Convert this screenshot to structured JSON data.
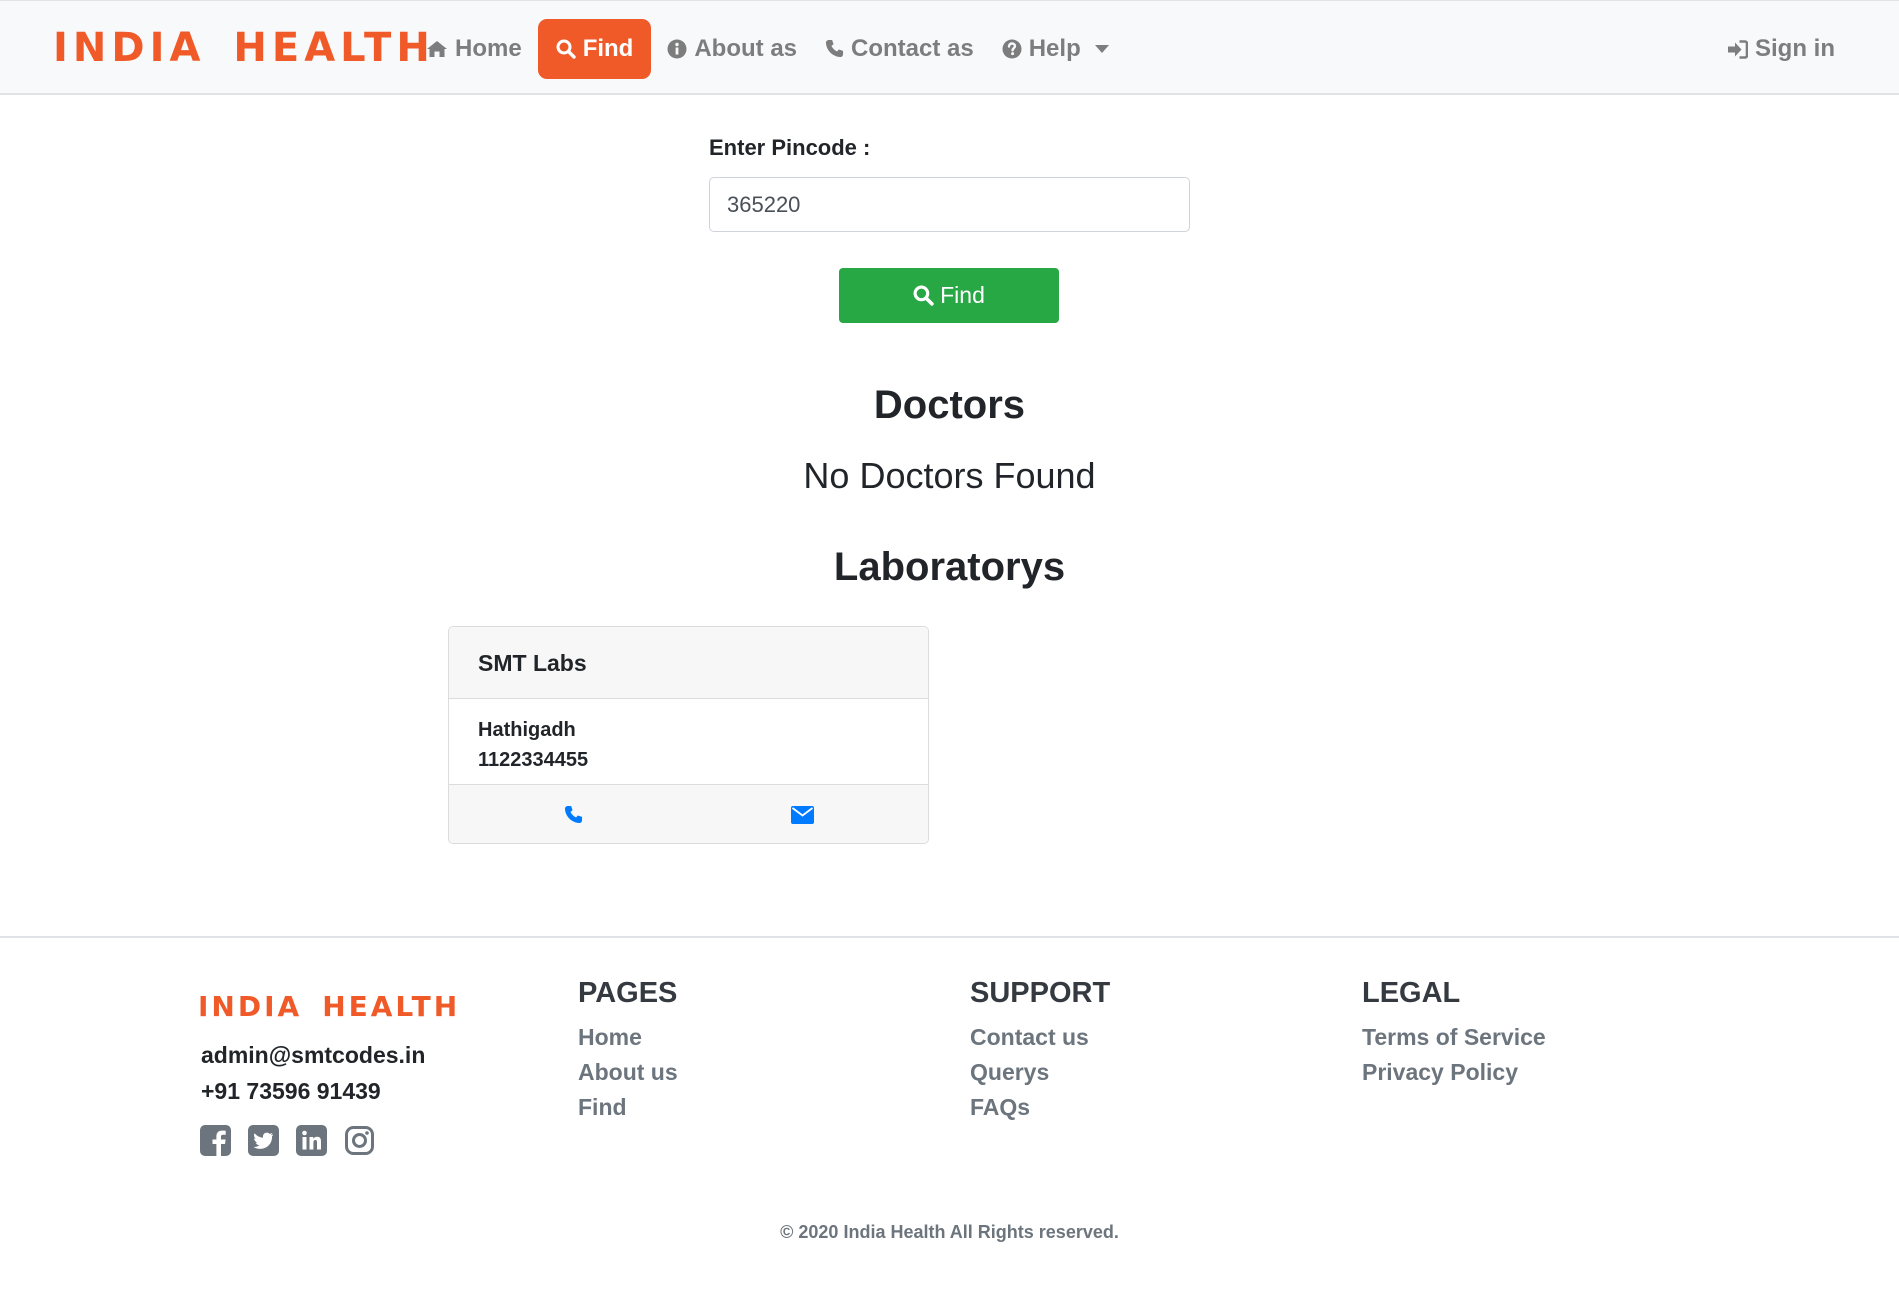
{
  "brand": {
    "word1": "INDIA",
    "word2": "HEALTH",
    "color": "#f05a28"
  },
  "nav": {
    "items": [
      {
        "label": "Home",
        "icon": "home-icon"
      },
      {
        "label": "Find",
        "icon": "search-icon",
        "active": true
      },
      {
        "label": "About as",
        "icon": "info-circle-icon"
      },
      {
        "label": "Contact as",
        "icon": "phone-icon"
      },
      {
        "label": "Help",
        "icon": "question-circle-icon",
        "dropdown": true
      }
    ],
    "signin": {
      "label": "Sign in",
      "icon": "sign-in-icon"
    }
  },
  "search": {
    "label": "Enter Pincode :",
    "value": "365220",
    "button_label": "Find",
    "button_color": "#28a745"
  },
  "doctors": {
    "heading": "Doctors",
    "empty_text": "No Doctors Found"
  },
  "labs": {
    "heading": "Laboratorys",
    "items": [
      {
        "name": "SMT Labs",
        "address": "Hathigadh",
        "phone": "1122334455",
        "actions": [
          "phone-icon",
          "envelope-icon"
        ]
      }
    ]
  },
  "footer": {
    "brand": {
      "word1": "INDIA",
      "word2": "HEALTH"
    },
    "email": "admin@smtcodes.in",
    "phone": "+91 73596 91439",
    "socials": [
      "facebook-icon",
      "twitter-icon",
      "linkedin-icon",
      "instagram-icon"
    ],
    "columns": [
      {
        "title": "PAGES",
        "links": [
          "Home",
          "About us",
          "Find"
        ]
      },
      {
        "title": "SUPPORT",
        "links": [
          "Contact us",
          "Querys",
          "FAQs"
        ]
      },
      {
        "title": "LEGAL",
        "links": [
          "Terms of Service",
          "Privacy Policy"
        ]
      }
    ],
    "copyright": "© 2020 India Health All Rights reserved."
  }
}
